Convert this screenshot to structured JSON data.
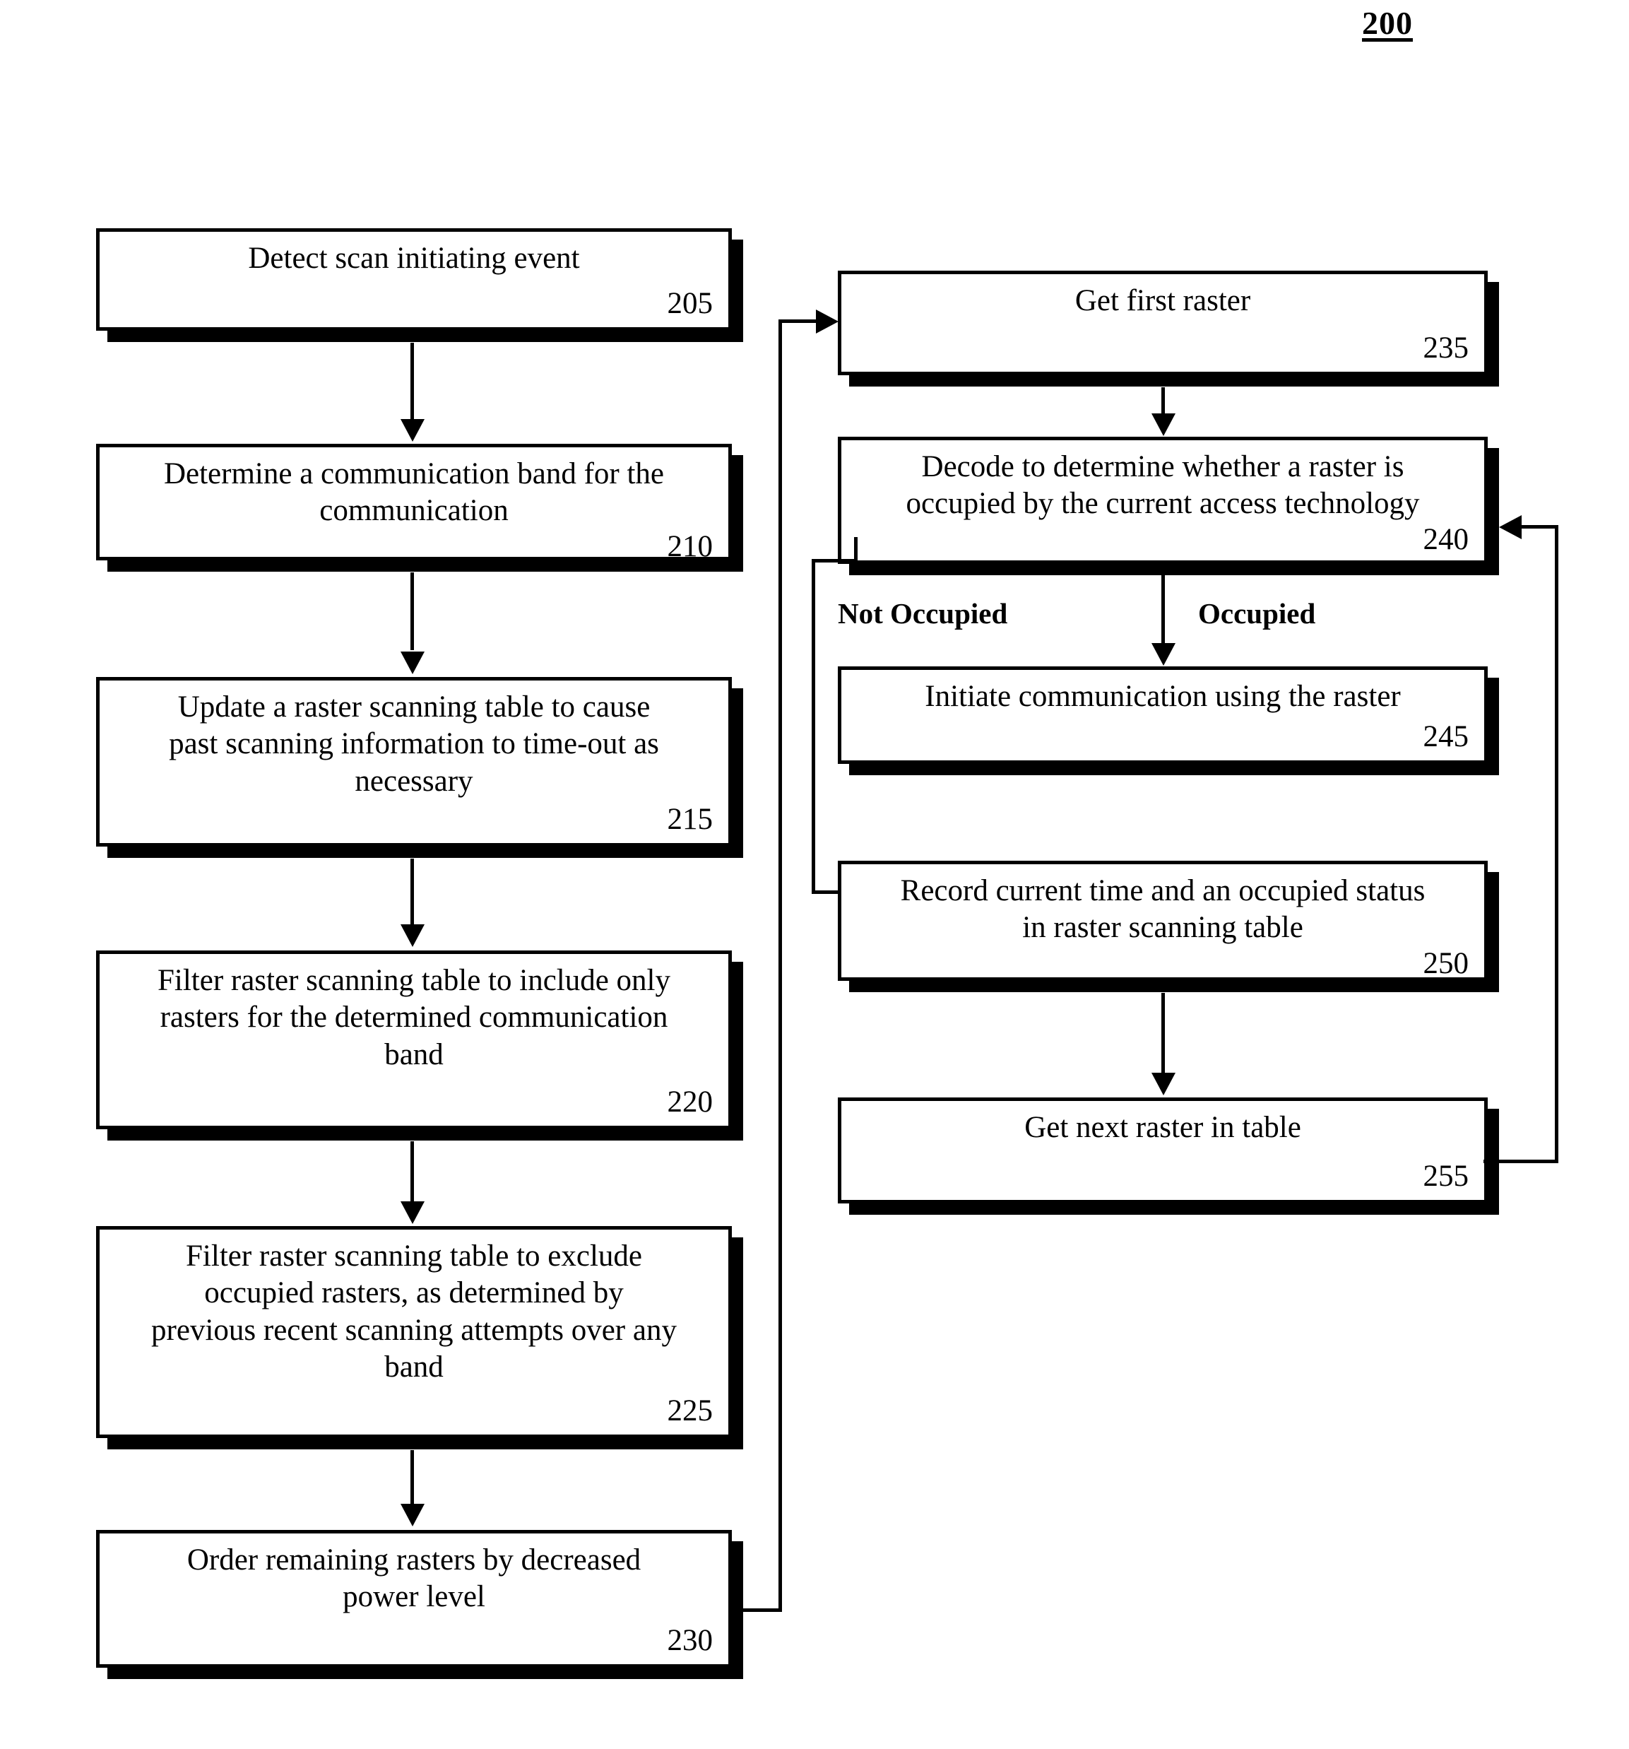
{
  "figure": {
    "number": "200"
  },
  "nodes": [
    {
      "id": "n205",
      "text": "Detect scan initiating event",
      "ref": "205"
    },
    {
      "id": "n210",
      "text": "Determine a communication band for the\ncommunication",
      "ref": "210"
    },
    {
      "id": "n215",
      "text": "Update a raster scanning table to cause\npast scanning information to time-out as\nnecessary",
      "ref": "215"
    },
    {
      "id": "n220",
      "text": "Filter raster scanning table to include only\nrasters for the determined communication\nband",
      "ref": "220"
    },
    {
      "id": "n225",
      "text": "Filter raster scanning table to exclude\noccupied rasters, as determined by\nprevious recent scanning attempts over any\nband",
      "ref": "225"
    },
    {
      "id": "n230",
      "text": "Order remaining rasters by decreased\npower level",
      "ref": "230"
    },
    {
      "id": "n235",
      "text": "Get first raster",
      "ref": "235"
    },
    {
      "id": "n240",
      "text": "Decode to determine whether a raster is\noccupied by the current access technology",
      "ref": "240"
    },
    {
      "id": "n245",
      "text": "Initiate communication using the raster",
      "ref": "245"
    },
    {
      "id": "n250",
      "text": "Record current time and an occupied status\nin raster scanning table",
      "ref": "250"
    },
    {
      "id": "n255",
      "text": "Get next raster in table",
      "ref": "255"
    }
  ],
  "branch_labels": {
    "not_occupied": "Not Occupied",
    "occupied": "Occupied"
  },
  "colors": {
    "line": "#000000",
    "background": "#ffffff",
    "shadow": "#000000"
  }
}
